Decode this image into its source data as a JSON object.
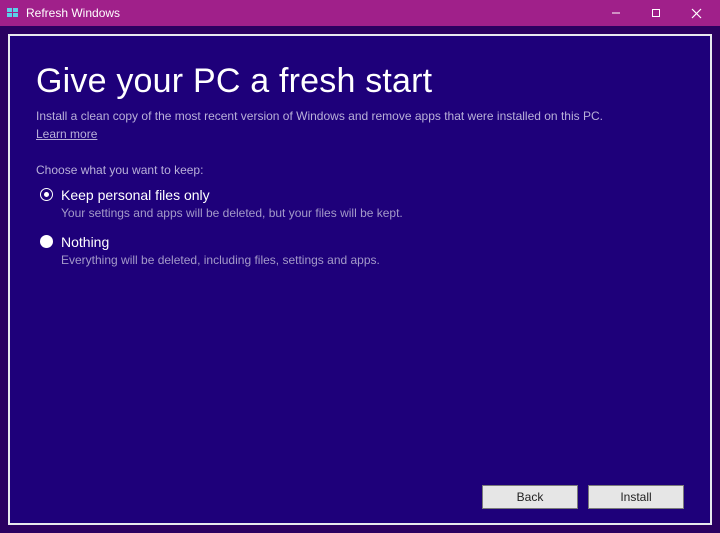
{
  "titlebar": {
    "title": "Refresh Windows"
  },
  "main": {
    "heading": "Give your PC a fresh start",
    "subtext": "Install a clean copy of the most recent version of Windows and remove apps that were installed on this PC.",
    "learn_more": "Learn more",
    "choose_label": "Choose what you want to keep:",
    "options": [
      {
        "title": "Keep personal files only",
        "desc": "Your settings and apps will be deleted, but your files will be kept.",
        "selected": true
      },
      {
        "title": "Nothing",
        "desc": "Everything will be deleted, including files, settings and apps.",
        "selected": false
      }
    ]
  },
  "buttons": {
    "back": "Back",
    "install": "Install"
  }
}
